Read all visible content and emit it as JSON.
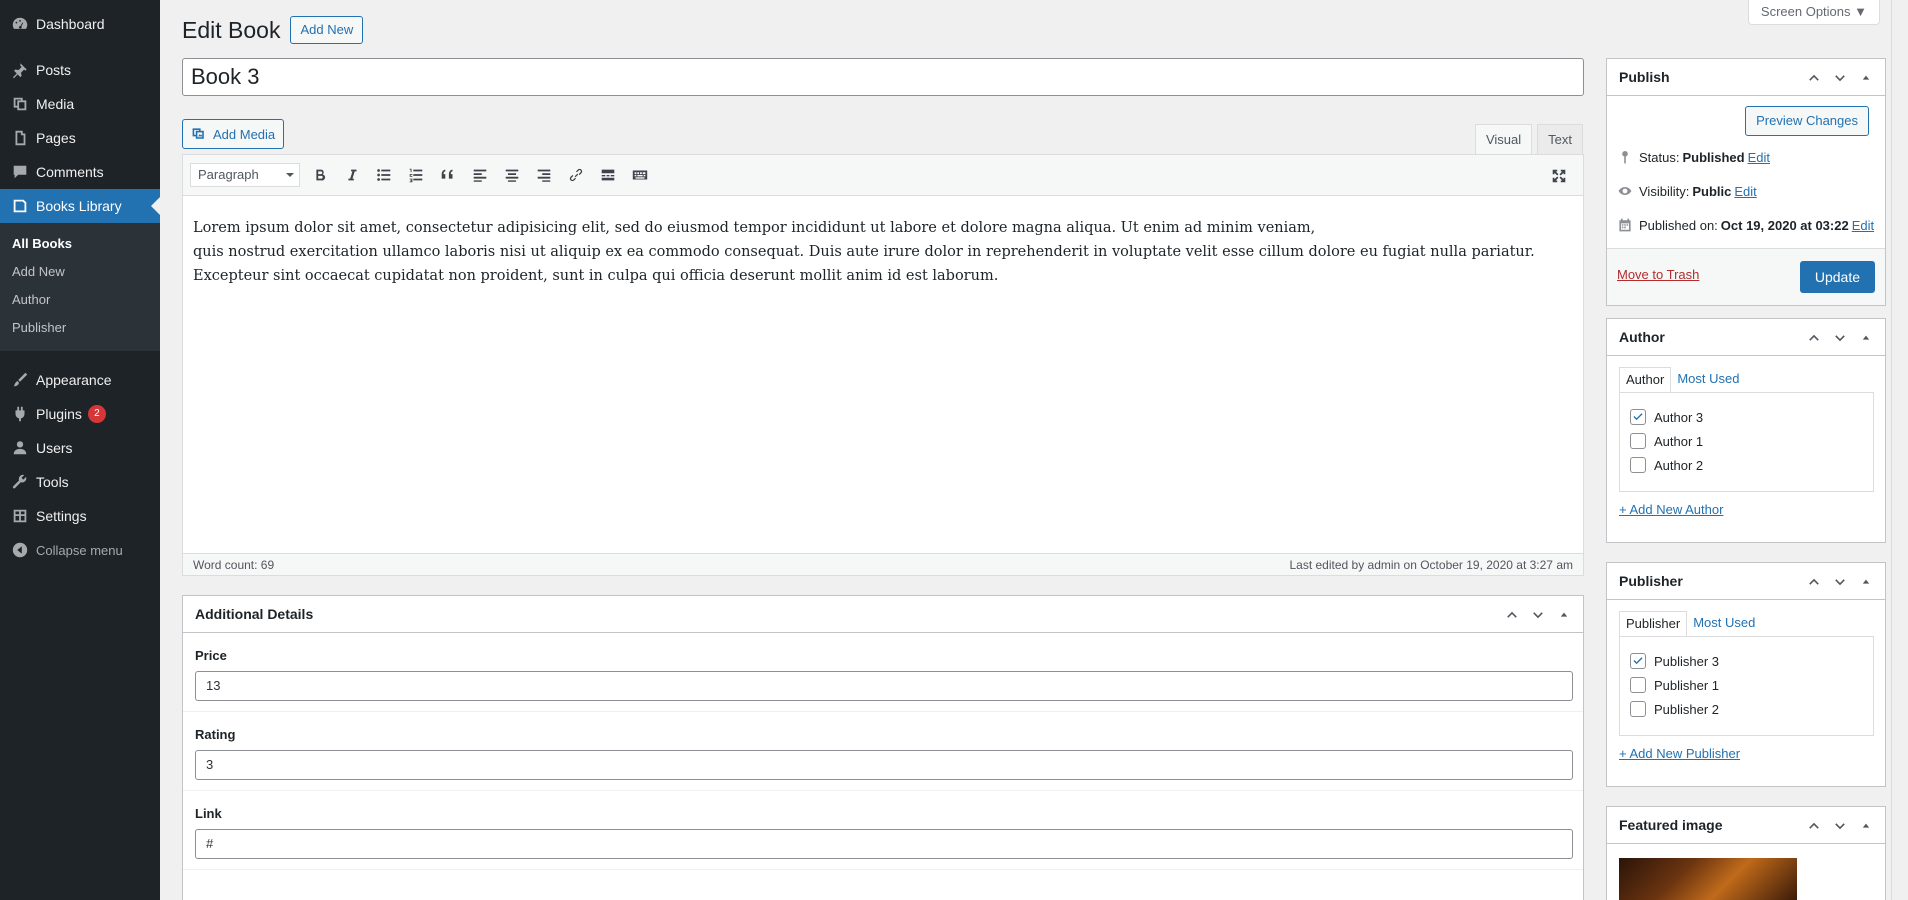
{
  "admin_menu": {
    "items_top": [
      {
        "label": "Dashboard",
        "icon": "dashboard-icon"
      },
      {
        "label": "Posts",
        "icon": "pin-icon"
      },
      {
        "label": "Media",
        "icon": "media-icon"
      },
      {
        "label": "Pages",
        "icon": "pages-icon"
      },
      {
        "label": "Comments",
        "icon": "comments-icon"
      },
      {
        "label": "Books Library",
        "icon": "book-icon"
      }
    ],
    "submenu": [
      "All Books",
      "Add New",
      "Author",
      "Publisher"
    ],
    "items_bottom": [
      {
        "label": "Appearance",
        "icon": "brush-icon"
      },
      {
        "label": "Plugins",
        "icon": "plug-icon",
        "badge": "2"
      },
      {
        "label": "Users",
        "icon": "users-icon"
      },
      {
        "label": "Tools",
        "icon": "wrench-icon"
      },
      {
        "label": "Settings",
        "icon": "settings-icon"
      }
    ],
    "collapse_label": "Collapse menu"
  },
  "header": {
    "screen_options": "Screen Options ▼",
    "page_title": "Edit Book",
    "add_new": "Add New"
  },
  "post": {
    "title": "Book 3"
  },
  "editor": {
    "add_media": "Add Media",
    "tab_visual": "Visual",
    "tab_text": "Text",
    "format": "Paragraph",
    "content_line1": "Lorem ipsum dolor sit amet, consectetur adipisicing elit, sed do eiusmod tempor incididunt ut labore et dolore magna aliqua. Ut enim ad minim veniam,",
    "content_line2": "quis nostrud exercitation ullamco laboris nisi ut aliquip ex ea commodo consequat. Duis aute irure dolor in reprehenderit in voluptate velit esse cillum dolore eu fugiat nulla pariatur. Excepteur sint occaecat cupidatat non proident, sunt in culpa qui officia deserunt mollit anim id est laborum.",
    "word_count": "Word count: 69",
    "last_edited": "Last edited by admin on October 19, 2020 at 3:27 am"
  },
  "additional_details": {
    "title": "Additional Details",
    "price_label": "Price",
    "price_value": "13",
    "rating_label": "Rating",
    "rating_value": "3",
    "link_label": "Link",
    "link_value": "#"
  },
  "publish": {
    "title": "Publish",
    "preview": "Preview Changes",
    "status_label": "Status:",
    "status_value": "Published",
    "visibility_label": "Visibility:",
    "visibility_value": "Public",
    "published_label": "Published on:",
    "published_value": "Oct 19, 2020 at 03:22",
    "edit": "Edit",
    "trash": "Move to Trash",
    "update": "Update"
  },
  "author_box": {
    "title": "Author",
    "tab_all": "Author",
    "tab_most_used": "Most Used",
    "items": [
      {
        "label": "Author 3",
        "checked": true
      },
      {
        "label": "Author 1",
        "checked": false
      },
      {
        "label": "Author 2",
        "checked": false
      }
    ],
    "add_new": "+ Add New Author"
  },
  "publisher_box": {
    "title": "Publisher",
    "tab_all": "Publisher",
    "tab_most_used": "Most Used",
    "items": [
      {
        "label": "Publisher 3",
        "checked": true
      },
      {
        "label": "Publisher 1",
        "checked": false
      },
      {
        "label": "Publisher 2",
        "checked": false
      }
    ],
    "add_new": "+ Add New Publisher"
  },
  "featured_image": {
    "title": "Featured image"
  },
  "colors": {
    "accent": "#2271b1",
    "menu_bg": "#1d2327",
    "badge": "#d63638"
  }
}
